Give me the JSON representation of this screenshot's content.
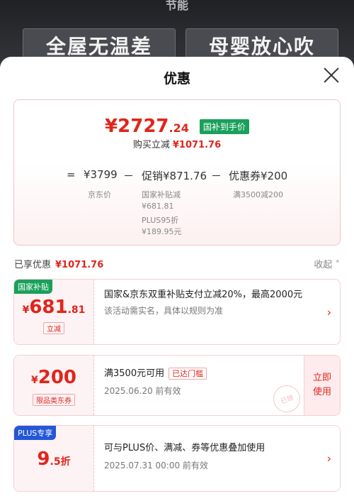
{
  "banner": {
    "top_text": "节能",
    "left": "全屋无温差",
    "right": "母婴放心吹"
  },
  "sheet": {
    "title": "优惠"
  },
  "summary": {
    "currency": "¥",
    "price_int": "2727",
    "price_dec": ".24",
    "price_tag": "国补到手价",
    "save_label": "购买立减",
    "save_value": "¥1071.76",
    "calc": {
      "eq": "=",
      "jd_price": "¥3799",
      "minus1": "－",
      "promo": "促销¥871.76",
      "minus2": "－",
      "coupon": "优惠券¥200"
    },
    "jd_price_label": "京东价",
    "promo_items": [
      "国家补贴减",
      "¥681.81",
      "PLUS95折",
      "¥189.95元"
    ],
    "coupon_label": "满3500减200"
  },
  "enjoyed": {
    "label": "已享优惠",
    "value": "¥1071.76",
    "collapse": "收起"
  },
  "cards": [
    {
      "badge": "国家补贴",
      "badge_color": "#1aa05a",
      "currency": "¥",
      "amount": "681",
      "decimal": ".81",
      "pill": "立减",
      "line1": "国家&京东双重补贴支付立减20%，最高2000元",
      "line2": "该活动需实名，具体以规则为准"
    },
    {
      "currency": "¥",
      "amount": "200",
      "pill": "限品类东券",
      "line1": "满3500元可用",
      "tag": "已达门槛",
      "line2": "2025.06.20 前有效",
      "use_button": "立即使用",
      "stamp": "已领"
    },
    {
      "badge": "PLUS专享",
      "badge_color": "#2357d8",
      "amount": "9",
      "decimal": ".5",
      "unit": "折",
      "line1": "可与PLUS价、满减、券等优惠叠加使用",
      "line2": "2025.07.31 00:00 前有效"
    }
  ]
}
